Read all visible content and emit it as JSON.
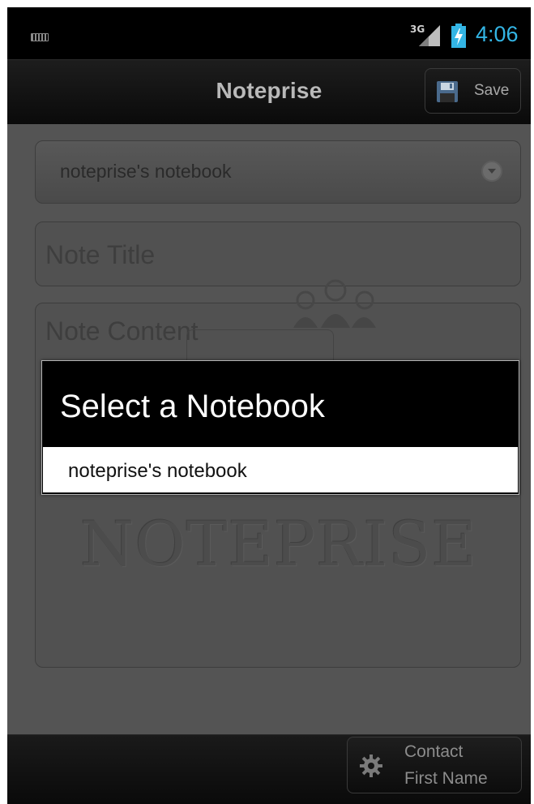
{
  "status_bar": {
    "network": "3G",
    "time": "4:06",
    "icons": [
      "keyboard-icon",
      "signal-icon",
      "battery-charging-icon"
    ],
    "clock_color": "#33b5e5"
  },
  "action_bar": {
    "title": "Noteprise",
    "save_label": "Save",
    "save_icon": "floppy-disk-icon"
  },
  "form": {
    "notebook_selected": "noteprise's notebook",
    "title_placeholder": "Note Title",
    "content_placeholder": "Note Content",
    "watermark": "NOTEPRISE"
  },
  "dialog": {
    "title": "Select a Notebook",
    "options": [
      "noteprise's notebook"
    ]
  },
  "bottom_bar": {
    "contact_line_1": "Contact",
    "contact_line_2": "First Name",
    "contact_icon": "gear-icon"
  }
}
